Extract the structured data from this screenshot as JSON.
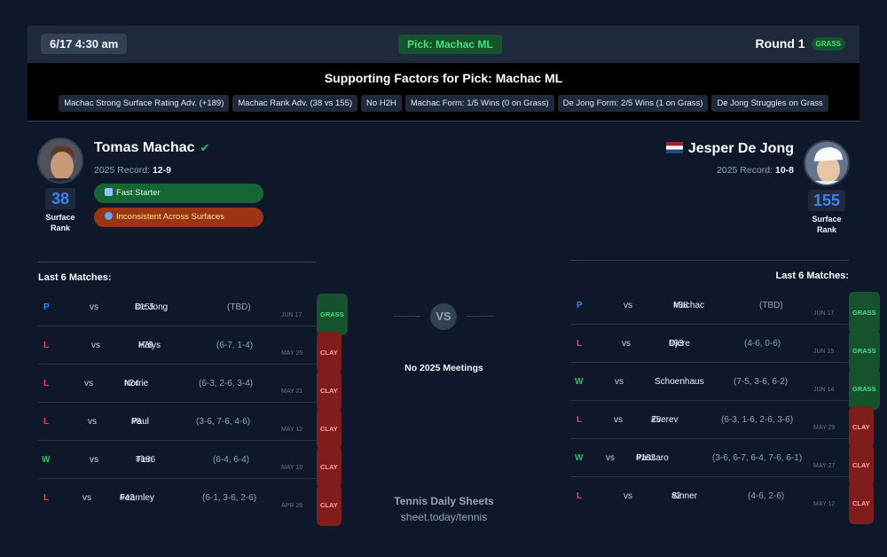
{
  "header": {
    "datetime": "6/17 4:30 am",
    "pick": "Pick: Machac ML",
    "round": "Round 1",
    "surface": "GRASS"
  },
  "factors": {
    "title": "Supporting Factors for Pick: Machac ML",
    "chips": [
      "Machac Strong Surface Rating Adv. (+189)",
      "Machac Rank Adv. (38 vs 155)",
      "No H2H",
      "Machac Form: 1/5 Wins (0 on Grass)",
      "De Jong Form: 2/5 Wins (1 on Grass)",
      "De Jong Struggles on Grass"
    ]
  },
  "player1": {
    "name": "Tomas Machac",
    "record_label": "2025 Record:",
    "record": "12-9",
    "rank": "38",
    "rank_label_1": "Surface",
    "rank_label_2": "Rank",
    "traits": [
      "Fast Starter",
      "Inconsistent Across Surfaces"
    ],
    "matches_title": "Last 6 Matches:",
    "matches": [
      {
        "res": "P",
        "vs": "vs",
        "seed": "#155",
        "opp": "De Jong",
        "score": "(TBD)",
        "surface": "GRASS",
        "date": "JUN 17"
      },
      {
        "res": "L",
        "vs": "vs",
        "seed": "#78",
        "opp": "Halys",
        "score": "(6-7, 1-4)",
        "surface": "CLAY",
        "date": "MAY 25"
      },
      {
        "res": "L",
        "vs": "vs",
        "seed": "#24",
        "opp": "Norrie",
        "score": "(6-3, 2-6, 3-4)",
        "surface": "CLAY",
        "date": "MAY 21"
      },
      {
        "res": "L",
        "vs": "vs",
        "seed": "#8",
        "opp": "Paul",
        "score": "(3-6, 7-6, 4-6)",
        "surface": "CLAY",
        "date": "MAY 12"
      },
      {
        "res": "W",
        "vs": "vs",
        "seed": "#186",
        "opp": "Tien",
        "score": "(6-4, 6-4)",
        "surface": "CLAY",
        "date": "MAY 10"
      },
      {
        "res": "L",
        "vs": "vs",
        "seed": "#42",
        "opp": "Fearnley",
        "score": "(6-1, 3-6, 2-6)",
        "surface": "CLAY",
        "date": "APR 26"
      }
    ]
  },
  "player2": {
    "name": "Jesper De Jong",
    "record_label": "2025 Record:",
    "record": "10-8",
    "rank": "155",
    "rank_label_1": "Surface",
    "rank_label_2": "Rank",
    "matches_title": "Last 6 Matches:",
    "matches": [
      {
        "res": "P",
        "vs": "vs",
        "seed": "#38",
        "opp": "Machac",
        "score": "(TBD)",
        "surface": "GRASS",
        "date": "JUN 17"
      },
      {
        "res": "L",
        "vs": "vs",
        "seed": "#93",
        "opp": "Djere",
        "score": "(4-6, 0-6)",
        "surface": "GRASS",
        "date": "JUN 15"
      },
      {
        "res": "W",
        "vs": "vs",
        "seed": "",
        "opp": "Schoenhaus",
        "score": "(7-5, 3-6, 6-2)",
        "surface": "GRASS",
        "date": "JUN 14"
      },
      {
        "res": "L",
        "vs": "vs",
        "seed": "#5",
        "opp": "Zverev",
        "score": "(6-3, 1-6, 2-6, 3-6)",
        "surface": "CLAY",
        "date": "MAY 29"
      },
      {
        "res": "W",
        "vs": "vs",
        "seed": "#102",
        "opp": "Passaro",
        "score": "(3-6, 6-7, 6-4, 7-6, 6-1)",
        "surface": "CLAY",
        "date": "MAY 27"
      },
      {
        "res": "L",
        "vs": "vs",
        "seed": "#2",
        "opp": "Sinner",
        "score": "(4-6, 2-6)",
        "surface": "CLAY",
        "date": "MAY 12"
      }
    ]
  },
  "center": {
    "vs": "VS",
    "meetings": "No 2025 Meetings",
    "brand": "Tennis Daily Sheets",
    "url": "sheet.today/tennis"
  }
}
